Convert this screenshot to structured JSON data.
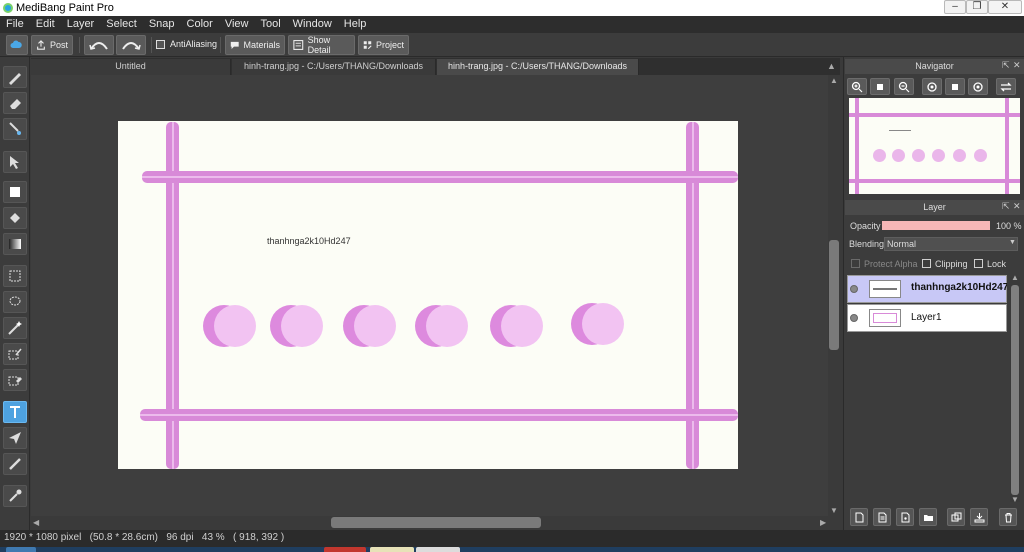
{
  "window": {
    "title": "MediBang Paint Pro"
  },
  "menu": [
    "File",
    "Edit",
    "Layer",
    "Select",
    "Snap",
    "Color",
    "View",
    "Tool",
    "Window",
    "Help"
  ],
  "toolbar": {
    "post": "Post",
    "antialiasing": "AntiAliasing",
    "materials": "Materials",
    "show_detail": "Show Detail",
    "project": "Project"
  },
  "tabs": [
    {
      "label": "Untitled",
      "active": false
    },
    {
      "label": "hinh-trang.jpg - C:/Users/THANG/Downloads",
      "active": false
    },
    {
      "label": "hinh-trang.jpg - C:/Users/THANG/Downloads",
      "active": true
    }
  ],
  "canvas": {
    "text": "thanhnga2k10Hd247",
    "background": "#fcfdf6",
    "stripe_color": "#d88ad8",
    "circle_back_color": "#dd8ade",
    "circle_front_color": "#f2c3f2"
  },
  "navigator": {
    "title": "Navigator"
  },
  "layer_panel": {
    "title": "Layer",
    "opacity_label": "Opacity",
    "opacity_value": "100 %",
    "opacity_percent": 100,
    "blending_label": "Blending",
    "blending_value": "Normal",
    "protect_alpha": "Protect Alpha",
    "clipping": "Clipping",
    "lock": "Lock",
    "layers": [
      {
        "name": "thanhnga2k10Hd247",
        "selected": true
      },
      {
        "name": "Layer1",
        "selected": false
      }
    ]
  },
  "status": {
    "text": "1920 * 1080 pixel   (50.8 * 28.6cm)   96 dpi   43 %   ( 918, 392 )"
  }
}
